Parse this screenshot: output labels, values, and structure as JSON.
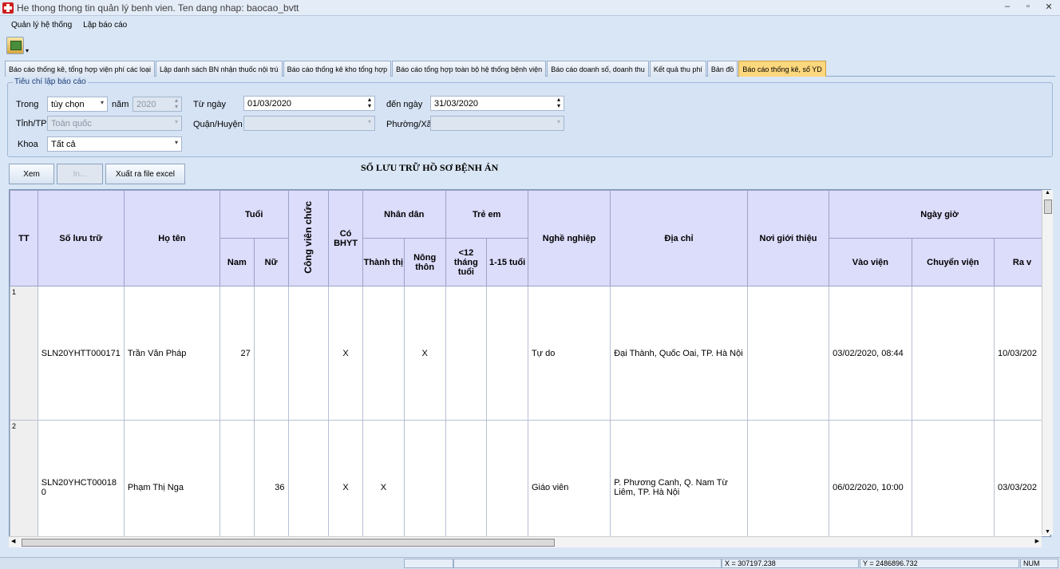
{
  "window": {
    "title": "He thong thong tin quản lý benh vien. Ten dang nhap: baocao_bvtt",
    "controls": [
      "–",
      "▫",
      "✕"
    ]
  },
  "menu": [
    "Quản lý hệ thống",
    "Lập báo cáo"
  ],
  "tabs": [
    {
      "label": "Báo cáo thống kê, tổng hợp viện phí các loại",
      "active": false
    },
    {
      "label": "Lập danh sách BN nhận thuốc nội trú",
      "active": false
    },
    {
      "label": "Báo cáo thống kê kho tổng hợp",
      "active": false
    },
    {
      "label": "Báo cáo tổng hợp toàn bộ hệ thống bệnh viện",
      "active": false
    },
    {
      "label": "Báo cáo doanh số, doanh thu",
      "active": false
    },
    {
      "label": "Kết quả thu phí",
      "active": false
    },
    {
      "label": "Bản đồ",
      "active": false
    },
    {
      "label": "Báo cáo thống kê, sổ YD",
      "active": true
    }
  ],
  "criteria": {
    "legend": "Tiêu chí lập báo cáo",
    "trong_label": "Trong",
    "trong_value": "tùy chọn",
    "nam_label": "năm",
    "nam_value": "2020",
    "tu_ngay_label": "Từ ngày",
    "tu_ngay_value": "01/03/2020",
    "den_ngay_label": "đến ngày",
    "den_ngay_value": "31/03/2020",
    "tinh_label": "Tỉnh/TP",
    "tinh_value": "Toàn quốc",
    "quan_label": "Quận/Huyện",
    "quan_value": "",
    "phuong_label": "Phường/Xã",
    "phuong_value": "",
    "khoa_label": "Khoa",
    "khoa_value": "Tất cả"
  },
  "actions": {
    "xem": "Xem",
    "in": "In...",
    "excel": "Xuất ra file excel"
  },
  "report_title": "SỔ LƯU TRỮ HỒ SƠ BỆNH ÁN",
  "table": {
    "headers": {
      "tt": "TT",
      "so_luu_tru": "Số lưu trữ",
      "ho_ten": "Họ tên",
      "tuoi": "Tuổi",
      "nam": "Nam",
      "nu": "Nữ",
      "cong_vien_chuc": "Công viên chức",
      "co_bhyt": "Có BHYT",
      "nhan_dan": "Nhân dân",
      "thanh_thi": "Thành thị",
      "nong_thon": "Nông thôn",
      "tre_em": "Trẻ em",
      "duoi_12_thang": "<12 tháng tuổi",
      "tu_1_15_tuoi": "1-15 tuổi",
      "nghe_nghiep": "Nghề nghiệp",
      "dia_chi": "Địa chỉ",
      "noi_gioi_thieu": "Nơi giới thiệu",
      "ngay_gio": "Ngày giờ",
      "vao_vien": "Vào viện",
      "chuyen_vien": "Chuyển viện",
      "ra_vien": "Ra v"
    },
    "rows": [
      {
        "tt": "1",
        "so_luu_tru": "SLN20YHTT000171",
        "ho_ten": "Trần Văn Pháp",
        "nam": "27",
        "nu": "",
        "cvc": "",
        "bhyt": "X",
        "thanh_thi": "",
        "nong_thon": "X",
        "duoi12": "",
        "tu1_15": "",
        "nghe_nghiep": "Tự do",
        "dia_chi": "Đại Thành, Quốc Oai, TP. Hà Nội",
        "noi_gt": "",
        "vao_vien": "03/02/2020, 08:44",
        "chuyen_vien": "",
        "ra_vien": "10/03/202"
      },
      {
        "tt": "2",
        "so_luu_tru": "SLN20YHCT00018 0",
        "ho_ten": "Phạm Thị Nga",
        "nam": "",
        "nu": "36",
        "cvc": "",
        "bhyt": "X",
        "thanh_thi": "X",
        "nong_thon": "",
        "duoi12": "",
        "tu1_15": "",
        "nghe_nghiep": "Giáo viên",
        "dia_chi": "P. Phương Canh, Q. Nam Từ Liêm, TP. Hà Nội",
        "noi_gt": "",
        "vao_vien": "06/02/2020, 10:00",
        "chuyen_vien": "",
        "ra_vien": "03/03/202"
      }
    ]
  },
  "status": {
    "x": "X = 307197.238",
    "y": "Y = 2486896.732",
    "num": "NUM"
  }
}
